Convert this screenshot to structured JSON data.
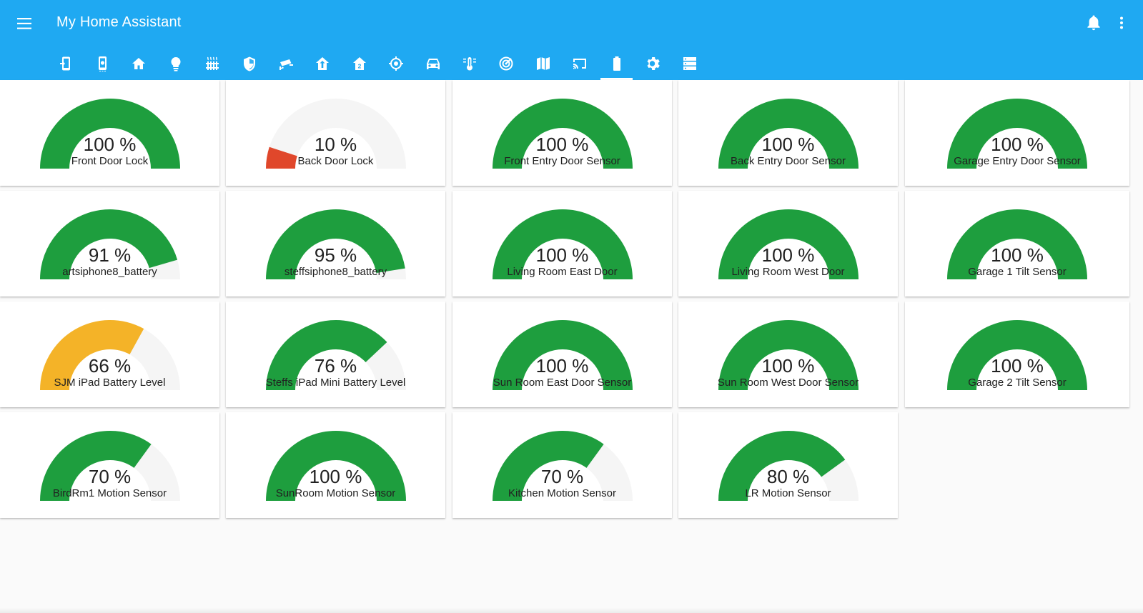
{
  "app": {
    "title": "My Home Assistant"
  },
  "icons": {
    "menu": "menu-icon",
    "notifications": "bell-icon",
    "more": "dots-vertical-icon"
  },
  "colors": {
    "header": "#1fa9f2",
    "gauge_bg": "#f5f5f5",
    "green": "#1e9e3e",
    "yellow": "#f4b328",
    "red": "#e0472b"
  },
  "tabs": [
    {
      "icon": "cellphone-arrow-icon",
      "active": false
    },
    {
      "icon": "cellphone-settings-icon",
      "active": false
    },
    {
      "icon": "home-icon",
      "active": false
    },
    {
      "icon": "lightbulb-icon",
      "active": false
    },
    {
      "icon": "radiator-icon",
      "active": false
    },
    {
      "icon": "shield-icon",
      "active": false
    },
    {
      "icon": "cctv-icon",
      "active": false
    },
    {
      "icon": "home-arrow-up-icon",
      "active": false
    },
    {
      "icon": "home-2-icon",
      "active": false
    },
    {
      "icon": "crosshairs-gps-icon",
      "active": false
    },
    {
      "icon": "car-icon",
      "active": false
    },
    {
      "icon": "thermometer-icon",
      "active": false
    },
    {
      "icon": "radar-icon",
      "active": false
    },
    {
      "icon": "map-icon",
      "active": false
    },
    {
      "icon": "cast-icon",
      "active": false
    },
    {
      "icon": "battery-icon",
      "active": true
    },
    {
      "icon": "settings-icon",
      "active": false
    },
    {
      "icon": "server-icon",
      "active": false
    }
  ],
  "gauges": [
    {
      "label": "Front Door Lock",
      "value": 100,
      "value_text": "100 %",
      "color": "green"
    },
    {
      "label": "Back Door Lock",
      "value": 10,
      "value_text": "10 %",
      "color": "red"
    },
    {
      "label": "Front Entry Door Sensor",
      "value": 100,
      "value_text": "100 %",
      "color": "green"
    },
    {
      "label": "Back Entry Door Sensor",
      "value": 100,
      "value_text": "100 %",
      "color": "green"
    },
    {
      "label": "Garage Entry Door Sensor",
      "value": 100,
      "value_text": "100 %",
      "color": "green"
    },
    {
      "label": "artsiphone8_battery",
      "value": 91,
      "value_text": "91 %",
      "color": "green"
    },
    {
      "label": "steffsiphone8_battery",
      "value": 95,
      "value_text": "95 %",
      "color": "green"
    },
    {
      "label": "Living Room East Door",
      "value": 100,
      "value_text": "100 %",
      "color": "green"
    },
    {
      "label": "Living Room West Door",
      "value": 100,
      "value_text": "100 %",
      "color": "green"
    },
    {
      "label": "Garage 1 Tilt Sensor",
      "value": 100,
      "value_text": "100 %",
      "color": "green"
    },
    {
      "label": "SJM iPad Battery Level",
      "value": 66,
      "value_text": "66 %",
      "color": "yellow"
    },
    {
      "label": "Steffs iPad Mini Battery Level",
      "value": 76,
      "value_text": "76 %",
      "color": "green"
    },
    {
      "label": "Sun Room East Door Sensor",
      "value": 100,
      "value_text": "100 %",
      "color": "green"
    },
    {
      "label": "Sun Room West Door Sensor",
      "value": 100,
      "value_text": "100 %",
      "color": "green"
    },
    {
      "label": "Garage 2 Tilt Sensor",
      "value": 100,
      "value_text": "100 %",
      "color": "green"
    },
    {
      "label": "BirdRm1 Motion Sensor",
      "value": 70,
      "value_text": "70 %",
      "color": "green"
    },
    {
      "label": "SunRoom Motion Sensor",
      "value": 100,
      "value_text": "100 %",
      "color": "green"
    },
    {
      "label": "Kitchen Motion Sensor",
      "value": 70,
      "value_text": "70 %",
      "color": "green"
    },
    {
      "label": "LR Motion Sensor",
      "value": 80,
      "value_text": "80 %",
      "color": "green"
    }
  ]
}
